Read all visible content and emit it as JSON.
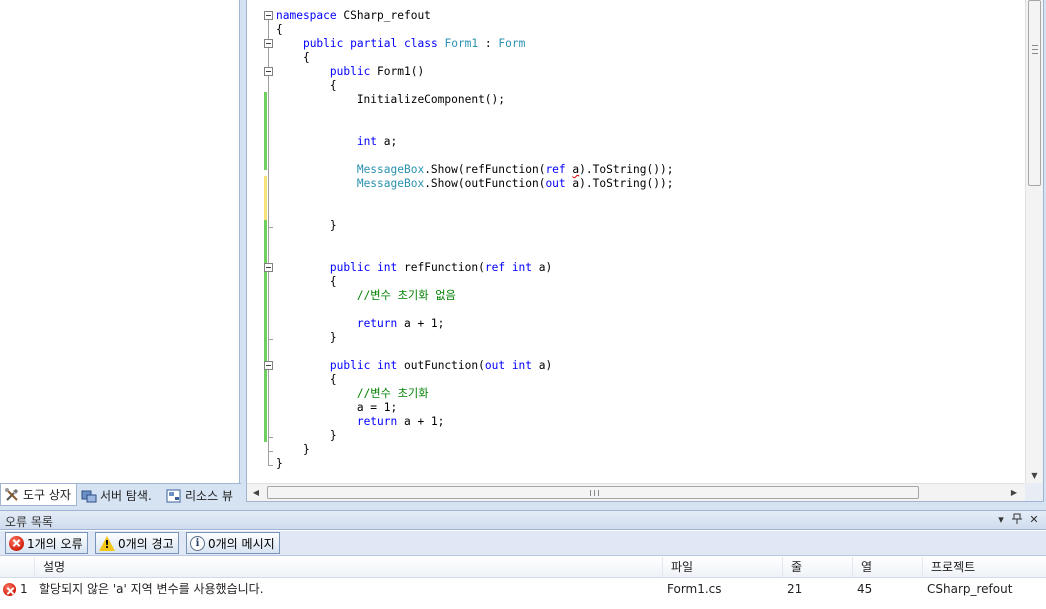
{
  "toolbox": {
    "tabs": [
      {
        "label": "도구 상자",
        "icon": "toolbox-icon",
        "active": true
      },
      {
        "label": "서버 탐색.",
        "icon": "server-explorer-icon",
        "active": false
      },
      {
        "label": "리소스 뷰",
        "icon": "resource-view-icon",
        "active": false
      }
    ]
  },
  "editor": {
    "lines": [
      {
        "segments": [
          {
            "t": "namespace",
            "c": "kw"
          },
          {
            "t": " CSharp_refout",
            "c": ""
          }
        ]
      },
      {
        "segments": [
          {
            "t": "{",
            "c": ""
          }
        ]
      },
      {
        "segments": [
          {
            "t": "    ",
            "c": ""
          },
          {
            "t": "public",
            "c": "kw"
          },
          {
            "t": " ",
            "c": ""
          },
          {
            "t": "partial",
            "c": "kw"
          },
          {
            "t": " ",
            "c": ""
          },
          {
            "t": "class",
            "c": "kw"
          },
          {
            "t": " ",
            "c": ""
          },
          {
            "t": "Form1",
            "c": "ty"
          },
          {
            "t": " : ",
            "c": ""
          },
          {
            "t": "Form",
            "c": "ty"
          }
        ]
      },
      {
        "segments": [
          {
            "t": "    {",
            "c": ""
          }
        ]
      },
      {
        "segments": [
          {
            "t": "        ",
            "c": ""
          },
          {
            "t": "public",
            "c": "kw"
          },
          {
            "t": " Form1()",
            "c": ""
          }
        ]
      },
      {
        "segments": [
          {
            "t": "        {",
            "c": ""
          }
        ]
      },
      {
        "segments": [
          {
            "t": "            InitializeComponent();",
            "c": ""
          }
        ]
      },
      {
        "segments": []
      },
      {
        "segments": []
      },
      {
        "segments": [
          {
            "t": "            ",
            "c": ""
          },
          {
            "t": "int",
            "c": "kw"
          },
          {
            "t": " a;",
            "c": ""
          }
        ]
      },
      {
        "segments": []
      },
      {
        "segments": [
          {
            "t": "            ",
            "c": ""
          },
          {
            "t": "MessageBox",
            "c": "ty"
          },
          {
            "t": ".Show(refFunction(",
            "c": ""
          },
          {
            "t": "ref",
            "c": "kw"
          },
          {
            "t": " ",
            "c": ""
          },
          {
            "t": "a",
            "c": "squiggle"
          },
          {
            "t": ").ToString());",
            "c": ""
          }
        ]
      },
      {
        "segments": [
          {
            "t": "            ",
            "c": ""
          },
          {
            "t": "MessageBox",
            "c": "ty"
          },
          {
            "t": ".Show(outFunction(",
            "c": ""
          },
          {
            "t": "out",
            "c": "kw"
          },
          {
            "t": " a).ToString());",
            "c": ""
          }
        ]
      },
      {
        "segments": []
      },
      {
        "segments": []
      },
      {
        "segments": [
          {
            "t": "        }",
            "c": ""
          }
        ]
      },
      {
        "segments": []
      },
      {
        "segments": []
      },
      {
        "segments": [
          {
            "t": "        ",
            "c": ""
          },
          {
            "t": "public",
            "c": "kw"
          },
          {
            "t": " ",
            "c": ""
          },
          {
            "t": "int",
            "c": "kw"
          },
          {
            "t": " refFunction(",
            "c": ""
          },
          {
            "t": "ref",
            "c": "kw"
          },
          {
            "t": " ",
            "c": ""
          },
          {
            "t": "int",
            "c": "kw"
          },
          {
            "t": " a)",
            "c": ""
          }
        ]
      },
      {
        "segments": [
          {
            "t": "        {",
            "c": ""
          }
        ]
      },
      {
        "segments": [
          {
            "t": "            ",
            "c": ""
          },
          {
            "t": "//변수 초기화 없음",
            "c": "cm"
          }
        ]
      },
      {
        "segments": []
      },
      {
        "segments": [
          {
            "t": "            ",
            "c": ""
          },
          {
            "t": "return",
            "c": "kw"
          },
          {
            "t": " a + 1;",
            "c": ""
          }
        ]
      },
      {
        "segments": [
          {
            "t": "        }",
            "c": ""
          }
        ]
      },
      {
        "segments": []
      },
      {
        "segments": [
          {
            "t": "        ",
            "c": ""
          },
          {
            "t": "public",
            "c": "kw"
          },
          {
            "t": " ",
            "c": ""
          },
          {
            "t": "int",
            "c": "kw"
          },
          {
            "t": " outFunction(",
            "c": ""
          },
          {
            "t": "out",
            "c": "kw"
          },
          {
            "t": " ",
            "c": ""
          },
          {
            "t": "int",
            "c": "kw"
          },
          {
            "t": " a)",
            "c": ""
          }
        ]
      },
      {
        "segments": [
          {
            "t": "        {",
            "c": ""
          }
        ]
      },
      {
        "segments": [
          {
            "t": "            ",
            "c": ""
          },
          {
            "t": "//변수 초기화",
            "c": "cm"
          }
        ]
      },
      {
        "segments": [
          {
            "t": "            a = 1;",
            "c": ""
          }
        ]
      },
      {
        "segments": [
          {
            "t": "            ",
            "c": ""
          },
          {
            "t": "return",
            "c": "kw"
          },
          {
            "t": " a + 1;",
            "c": ""
          }
        ]
      },
      {
        "segments": [
          {
            "t": "        }",
            "c": ""
          }
        ]
      },
      {
        "segments": [
          {
            "t": "    }",
            "c": ""
          }
        ]
      },
      {
        "segments": [
          {
            "t": "}",
            "c": ""
          }
        ]
      }
    ],
    "colors": {
      "keyword": "#0000ff",
      "type": "#2b91af",
      "comment": "#008000",
      "saved_change": "#6fcf5f",
      "unsaved_change": "#f7e27a"
    }
  },
  "error_list": {
    "title": "오류 목록",
    "filters": [
      {
        "label": "1개의 오류",
        "icon": "error-icon"
      },
      {
        "label": "0개의 경고",
        "icon": "warning-icon"
      },
      {
        "label": "0개의 메시지",
        "icon": "info-icon"
      }
    ],
    "columns": [
      "설명",
      "파일",
      "줄",
      "열",
      "프로젝트"
    ],
    "rows": [
      {
        "index": "1",
        "description": "할당되지 않은 'a' 지역 변수를 사용했습니다.",
        "file": "Form1.cs",
        "line": "21",
        "column": "45",
        "project": "CSharp_refout"
      }
    ]
  }
}
